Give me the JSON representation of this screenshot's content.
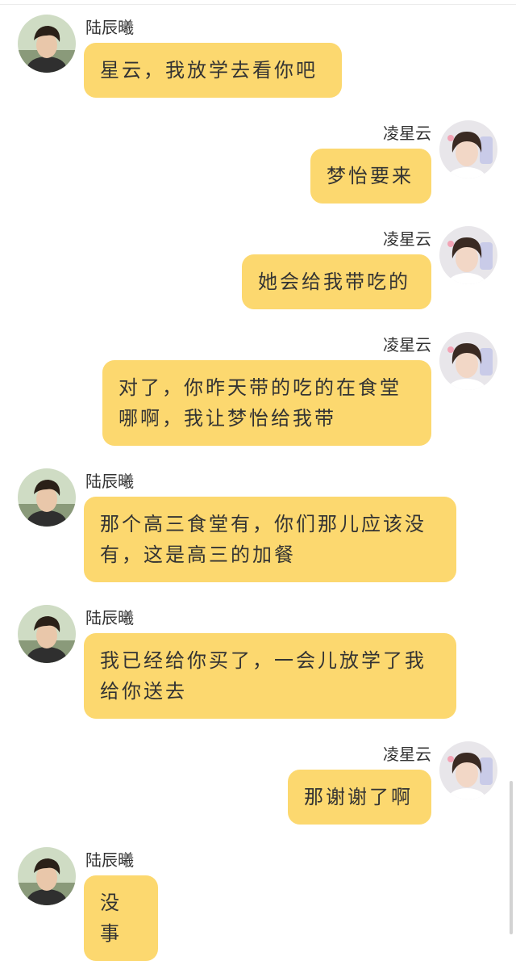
{
  "contacts": {
    "boy": "陆辰曦",
    "girl": "凌星云"
  },
  "messages": [
    {
      "side": "left",
      "name": "陆辰曦",
      "text": "星云，我放学去看你吧"
    },
    {
      "side": "right",
      "name": "凌星云",
      "text": "梦怡要来"
    },
    {
      "side": "right",
      "name": "凌星云",
      "text": "她会给我带吃的"
    },
    {
      "side": "right",
      "name": "凌星云",
      "text": "对了，你昨天带的吃的在食堂哪啊，我让梦怡给我带"
    },
    {
      "side": "left",
      "name": "陆辰曦",
      "text": "那个高三食堂有，你们那儿应该没有，这是高三的加餐"
    },
    {
      "side": "left",
      "name": "陆辰曦",
      "text": "我已经给你买了，一会儿放学了我给你送去"
    },
    {
      "side": "right",
      "name": "凌星云",
      "text": "那谢谢了啊"
    },
    {
      "side": "left",
      "name": "陆辰曦",
      "text": "没事"
    }
  ],
  "colors": {
    "bubble": "#fcd86f",
    "text": "#333333",
    "background": "#ffffff"
  },
  "icons": {
    "boy_avatar": "boy-avatar-photo",
    "girl_avatar": "girl-avatar-photo"
  }
}
